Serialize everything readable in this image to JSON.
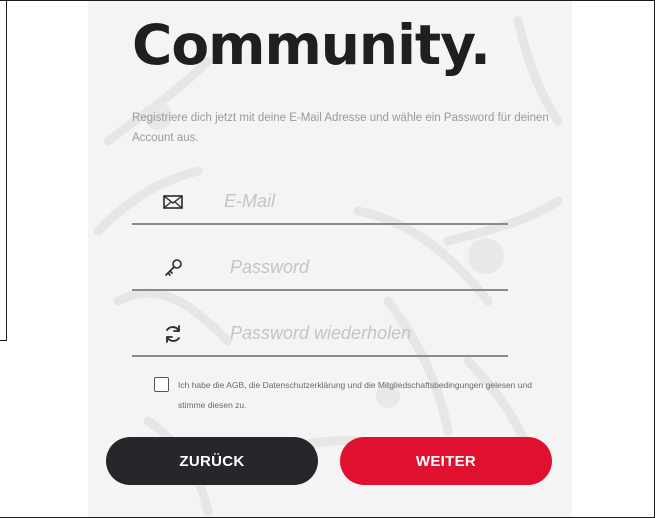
{
  "header": {
    "title": "Community."
  },
  "intro": {
    "text": "Registriere dich jetzt mit deine E-Mail Adresse und wähle ein Password für deinen Account aus."
  },
  "form": {
    "email": {
      "placeholder": "E-Mail",
      "icon": "envelope-icon"
    },
    "password": {
      "placeholder": "Password",
      "icon": "key-icon"
    },
    "password_repeat": {
      "placeholder": "Password wiederholen",
      "icon": "refresh-icon"
    }
  },
  "consent": {
    "checked": false,
    "text": "Ich habe die AGB, die Datenschutzerklärung und die Mitgliedschaftsbedingungen gelesen und stimme diesen zu."
  },
  "buttons": {
    "back_label": "ZURÜCK",
    "next_label": "WEITER"
  },
  "colors": {
    "card_background": "#f4f4f4",
    "title": "#1f1f22",
    "back_button": "#26272b",
    "next_button": "#e0102f"
  }
}
